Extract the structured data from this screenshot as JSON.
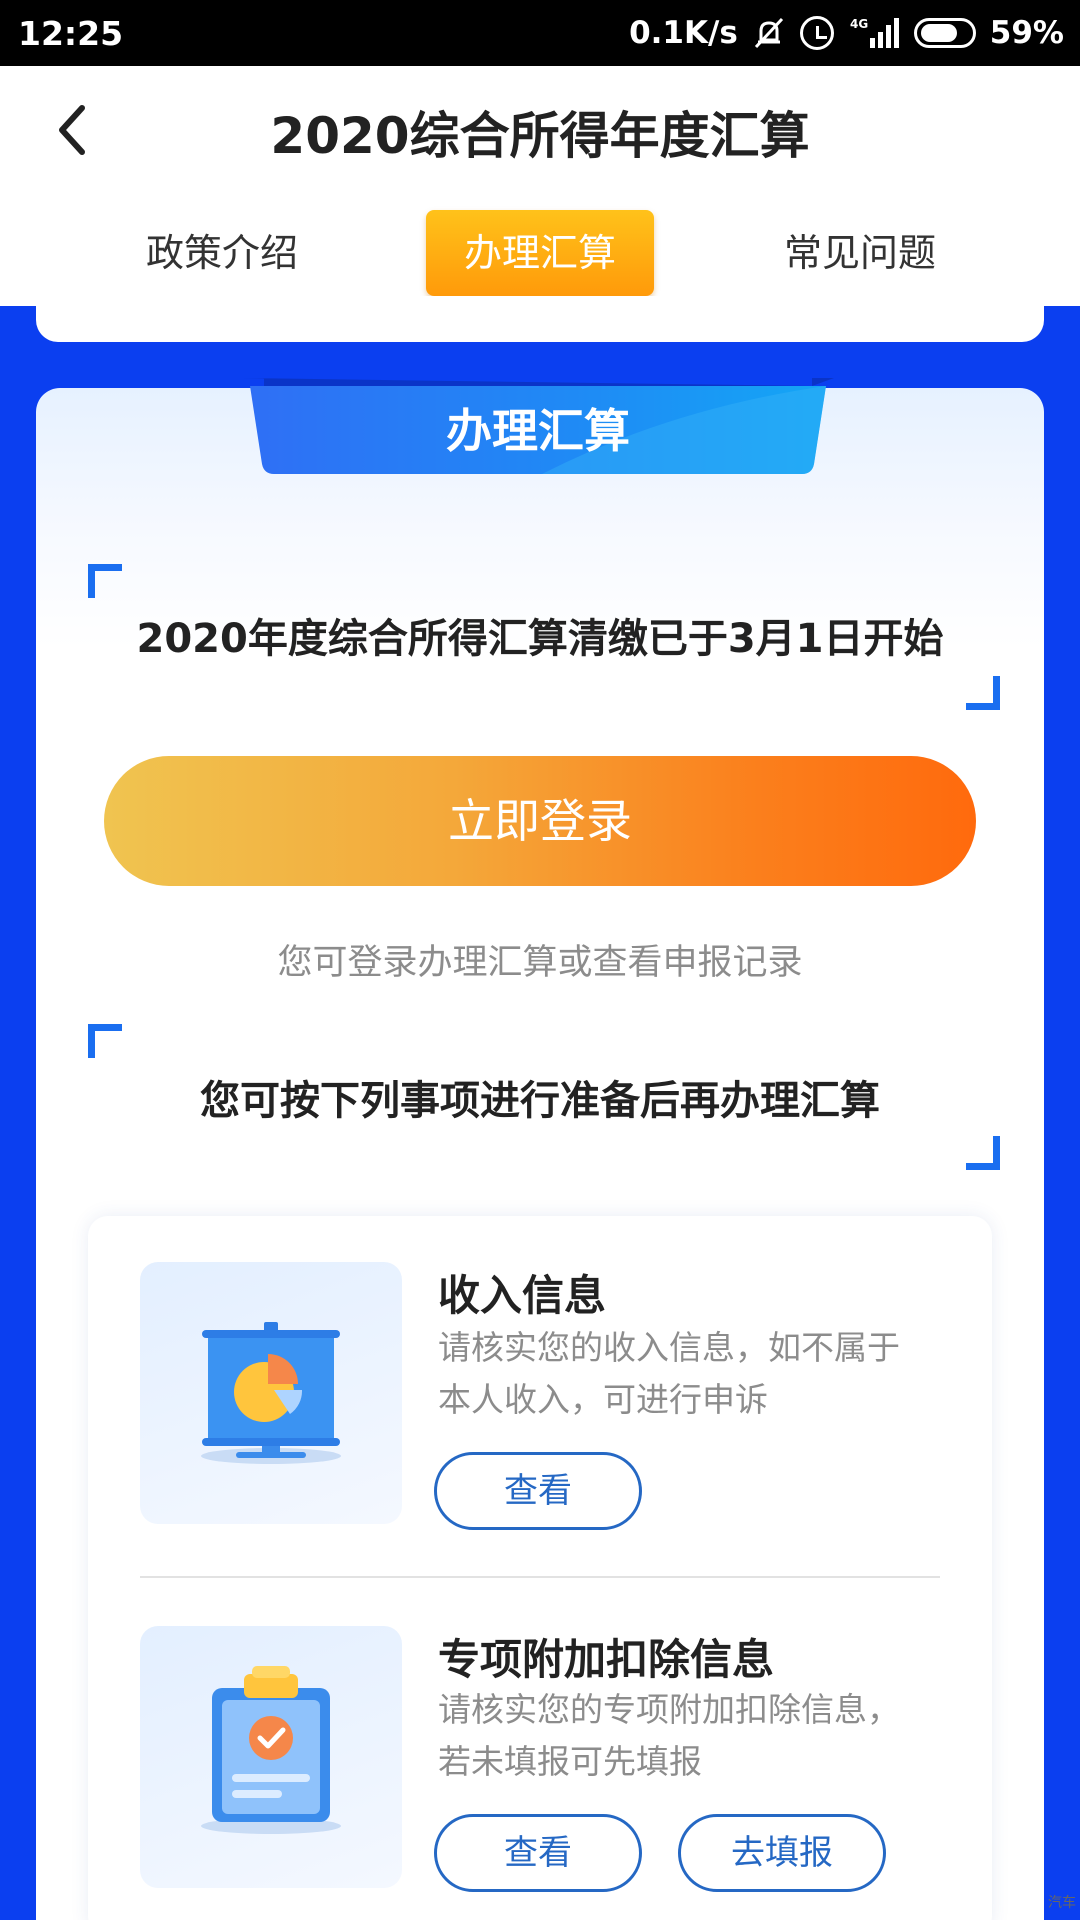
{
  "status_bar": {
    "time": "12:25",
    "network_speed": "0.1K/s",
    "network_type": "4G",
    "battery": "59%"
  },
  "header": {
    "title": "2020综合所得年度汇算",
    "tabs": [
      {
        "label": "政策介绍",
        "active": false
      },
      {
        "label": "办理汇算",
        "active": true
      },
      {
        "label": "常见问题",
        "active": false
      }
    ]
  },
  "main": {
    "ribbon_title": "办理汇算",
    "notice_start": "2020年度综合所得汇算清缴已于3月1日开始",
    "login_button": "立即登录",
    "login_hint": "您可登录办理汇算或查看申报记录",
    "notice_prepare": "您可按下列事项进行准备后再办理汇算",
    "items": [
      {
        "icon": "presentation-chart-icon",
        "title": "收入信息",
        "desc_line1": "请核实您的收入信息，如不属于",
        "desc_line2": "本人收入，可进行申诉",
        "buttons": [
          "查看"
        ]
      },
      {
        "icon": "clipboard-check-icon",
        "title": "专项附加扣除信息",
        "desc_line1": "请核实您的专项附加扣除信息，",
        "desc_line2": "若未填报可先填报",
        "buttons": [
          "查看",
          "去填报"
        ]
      }
    ]
  },
  "watermark": "汽车",
  "colors": {
    "brand_blue": "#0b3ff0",
    "tab_active": "#ff9a0a",
    "button_gradient_start": "#f0c450",
    "button_gradient_end": "#ff6a0d",
    "outline_button": "#2568c4"
  }
}
